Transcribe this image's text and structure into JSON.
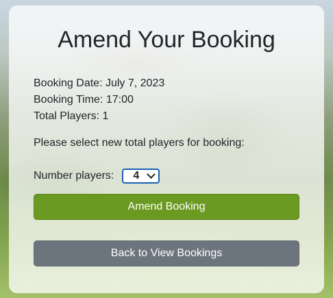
{
  "page": {
    "title": "Amend Your Booking"
  },
  "booking": {
    "date_line": "Booking Date: July 7, 2023",
    "time_line": "Booking Time: 17:00",
    "players_line": "Total Players: 1"
  },
  "form": {
    "prompt": "Please select new total players for booking:",
    "players_label": "Number players:",
    "players_selected": "4"
  },
  "buttons": {
    "amend_label": "Amend Booking",
    "back_label": "Back to View Bookings"
  },
  "colors": {
    "amend_button": "#6b9a22",
    "back_button": "#6c757d",
    "select_border": "#1a5fb4"
  },
  "icons": {
    "select_arrow": "chevron-down-icon"
  }
}
